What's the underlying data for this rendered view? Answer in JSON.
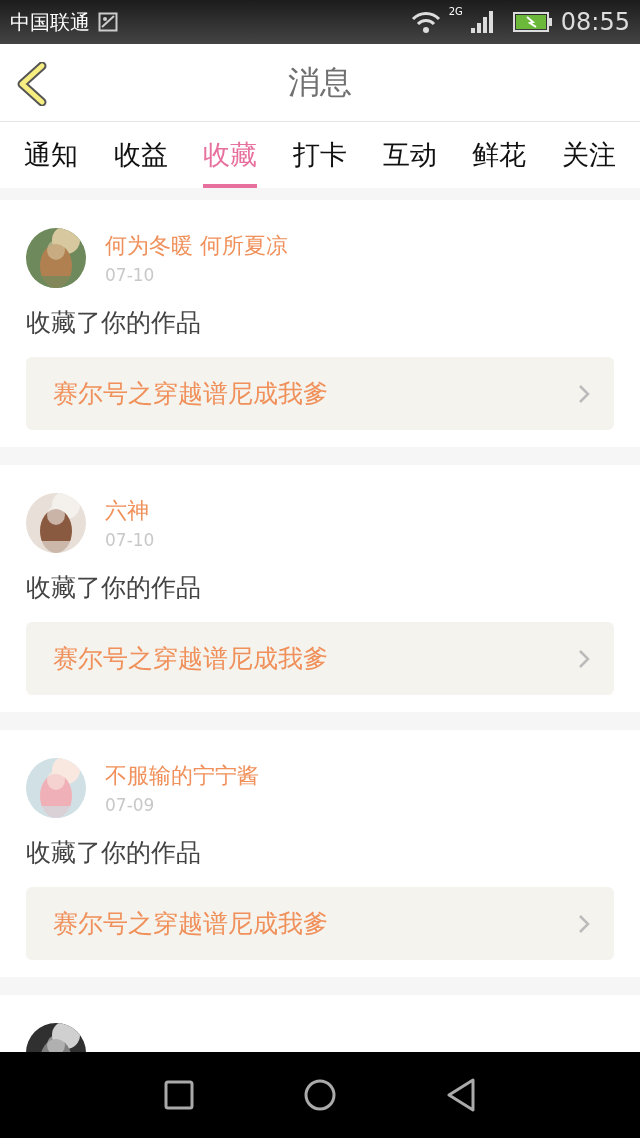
{
  "status_bar": {
    "carrier": "中国联通",
    "network": "2G",
    "time": "08:55"
  },
  "header": {
    "title": "消息"
  },
  "tabs": [
    {
      "label": "通知",
      "selected": false
    },
    {
      "label": "收益",
      "selected": false
    },
    {
      "label": "收藏",
      "selected": true
    },
    {
      "label": "打卡",
      "selected": false
    },
    {
      "label": "互动",
      "selected": false
    },
    {
      "label": "鲜花",
      "selected": false
    },
    {
      "label": "关注",
      "selected": false
    }
  ],
  "messages": [
    {
      "user": "何为冬暖 何所夏凉",
      "date": "07-10",
      "action": "收藏了你的作品",
      "work": "赛尔号之穿越谱尼成我爹",
      "avatar": {
        "kind": "picture"
      }
    },
    {
      "user": "六神",
      "date": "07-10",
      "action": "收藏了你的作品",
      "work": "赛尔号之穿越谱尼成我爹",
      "avatar": {
        "kind": "picture"
      }
    },
    {
      "user": "不服输的宁宁酱",
      "date": "07-09",
      "action": "收藏了你的作品",
      "work": "赛尔号之穿越谱尼成我爹",
      "avatar": {
        "kind": "picture"
      }
    },
    {
      "avatar": {
        "kind": "picture"
      }
    }
  ]
}
